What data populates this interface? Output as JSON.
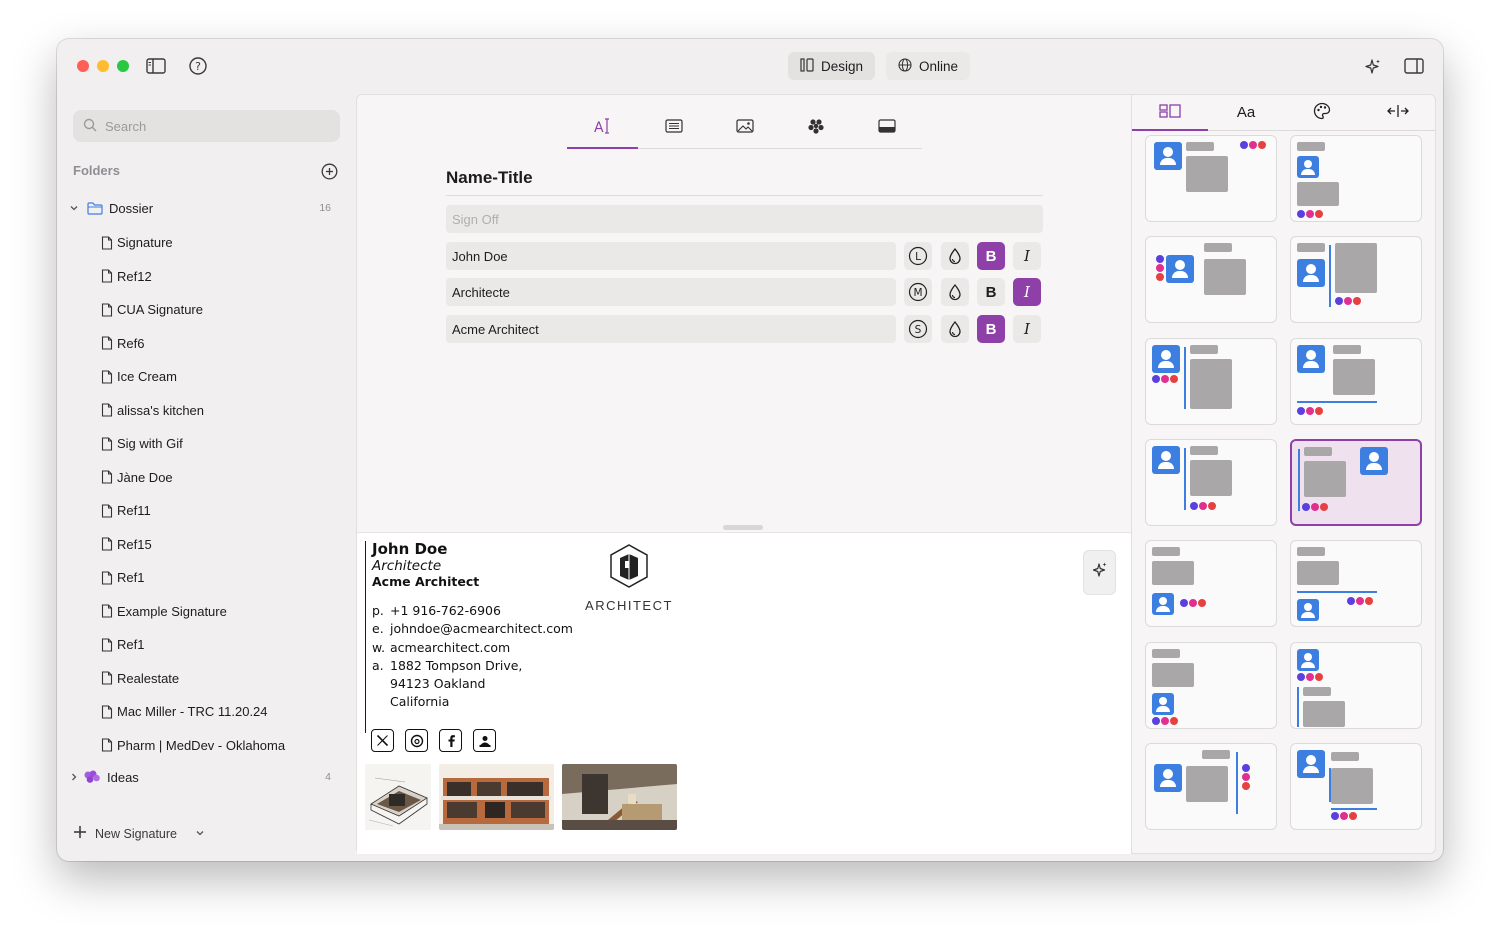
{
  "toolbar": {
    "design_label": "Design",
    "online_label": "Online"
  },
  "sidebar": {
    "search_placeholder": "Search",
    "folders_header": "Folders",
    "folders": [
      {
        "name": "Dossier",
        "count": "16"
      },
      {
        "name": "Ideas",
        "count": "4"
      }
    ],
    "items": [
      "Signature",
      "Ref12",
      "CUA Signature",
      "Ref6",
      "Ice Cream",
      "alissa's kitchen",
      "Sig with Gif",
      "Jàne Doe",
      "Ref11",
      "Ref15",
      "Ref1",
      "Example Signature",
      "Ref1",
      "Realestate",
      "Mac Miller - TRC 11.20.24",
      "Pharm | MedDev - Oklahoma"
    ],
    "new_signature_label": "New Signature"
  },
  "editor": {
    "section_title": "Name-Title",
    "signoff_placeholder": "Sign Off",
    "fields": [
      {
        "value": "John Doe",
        "size_badge": "L",
        "bold": true,
        "italic": false
      },
      {
        "value": "Architecte",
        "size_badge": "M",
        "bold": false,
        "italic": true
      },
      {
        "value": "Acme Architect",
        "size_badge": "S",
        "bold": true,
        "italic": false
      }
    ],
    "bold_glyph": "B",
    "italic_glyph": "I"
  },
  "preview": {
    "name": "John Doe",
    "title": "Architecte",
    "company": "Acme Architect",
    "phone_key": "p.",
    "phone": "+1 916-762-6906",
    "email_key": "e.",
    "email": "johndoe@acmearchitect.com",
    "web_key": "w.",
    "web": "acmearchitect.com",
    "address_key": "a.",
    "address_lines": [
      "1882 Tompson Drive,",
      "94123 Oakland",
      "California"
    ],
    "logo_text": "ARCHITECT"
  },
  "right_panel": {
    "font_tab_label": "Aa",
    "selected_template_index": 7
  },
  "colors": {
    "accent": "#8e3fa8",
    "avatar_blue": "#3d7fe0",
    "dot_purple": "#5b3fe0",
    "dot_pink": "#e0308f",
    "dot_red": "#e64040"
  }
}
